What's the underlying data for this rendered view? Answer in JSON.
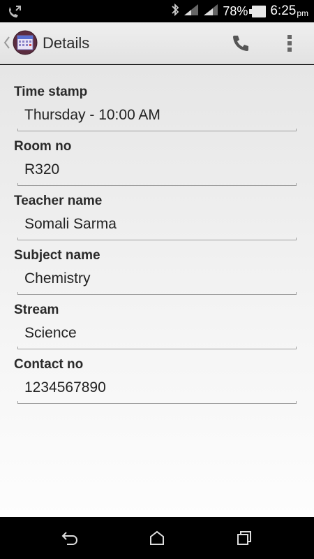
{
  "status_bar": {
    "battery_percent": "78%",
    "time": "6:25",
    "ampm": "pm",
    "icons": [
      "call-forward-icon",
      "bluetooth-icon",
      "signal-icon",
      "signal-icon",
      "battery-icon"
    ]
  },
  "action_bar": {
    "title": "Details",
    "icons": [
      "back-chevron-icon",
      "app-calendar-icon",
      "phone-icon",
      "overflow-menu-icon"
    ]
  },
  "fields": [
    {
      "label": "Time stamp",
      "value": "Thursday - 10:00 AM"
    },
    {
      "label": "Room no",
      "value": "R320"
    },
    {
      "label": "Teacher name",
      "value": "Somali Sarma"
    },
    {
      "label": "Subject name",
      "value": "Chemistry"
    },
    {
      "label": "Stream",
      "value": "Science"
    },
    {
      "label": "Contact no",
      "value": "1234567890"
    }
  ],
  "nav_bar": {
    "icons": [
      "back-icon",
      "home-icon",
      "recent-apps-icon"
    ]
  },
  "colors": {
    "action_bar_bg": "#e9e9e9",
    "content_bg": "#f0f0f0",
    "label_text": "#2a2a2a",
    "underline": "#9e9e9e"
  }
}
